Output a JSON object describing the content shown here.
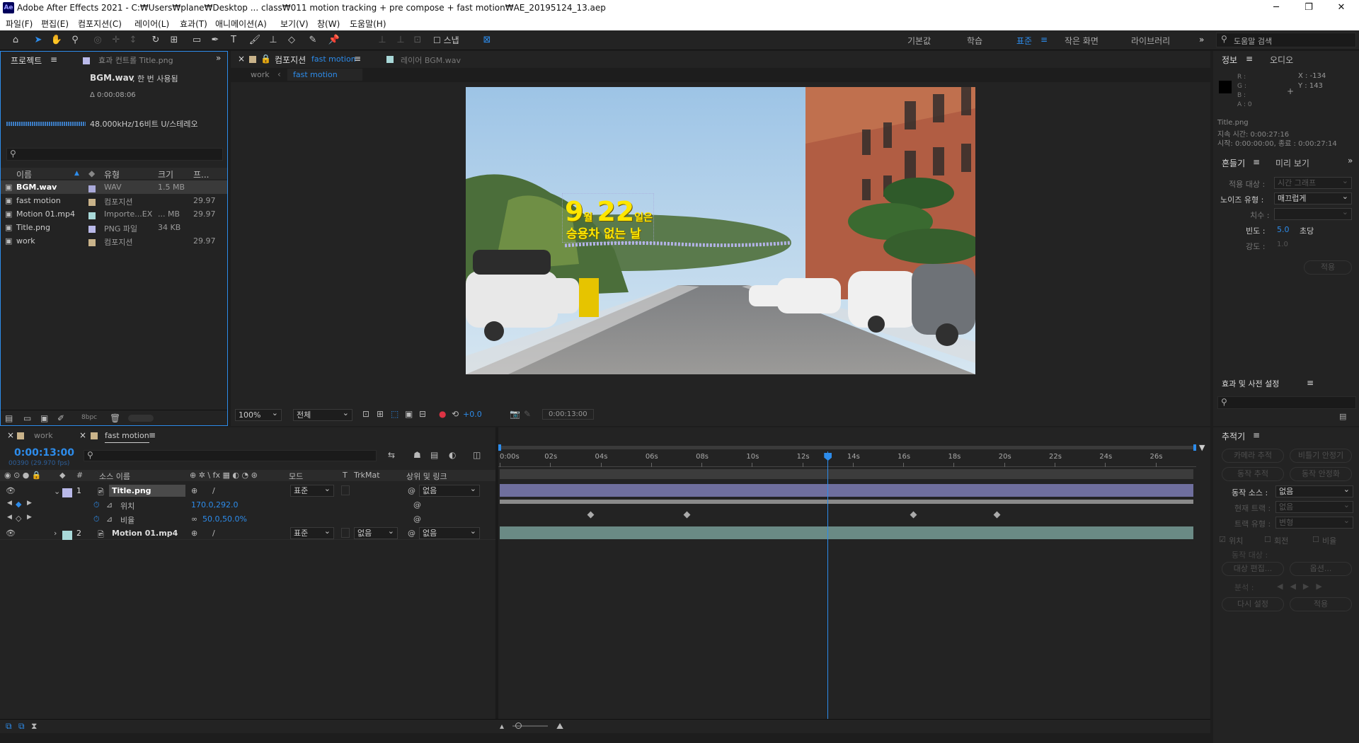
{
  "window": {
    "app_icon": "Ae",
    "title": "Adobe After Effects 2021 - C:₩Users₩plane₩Desktop ... class₩011 motion tracking + pre compose + fast motion₩AE_20195124_13.aep",
    "minimize": "─",
    "maximize": "❐",
    "close": "✕"
  },
  "menu": [
    "파일(F)",
    "편집(E)",
    "컴포지션(C)",
    "레이어(L)",
    "효과(T)",
    "애니메이션(A)",
    "보기(V)",
    "창(W)",
    "도움말(H)"
  ],
  "workspaces": {
    "items": [
      "기본값",
      "학습",
      "표준",
      "작은 화면",
      "라이브러리"
    ],
    "active": "표준",
    "search_placeholder": "도움말 검색",
    "expand": "»"
  },
  "project": {
    "tab": "프로젝트",
    "tab2": "효과 컨트롤 Title.png",
    "selected_name": "BGM.wav",
    "usage": ", 한 번 사용됨",
    "duration": "Δ 0:00:08:06",
    "audio_info": "48.000kHz/16비트 U/스테레오",
    "search_placeholder": "",
    "cols": [
      "이름",
      "유형",
      "크기",
      "프..."
    ],
    "items": [
      {
        "name": "BGM.wav",
        "type": "WAV",
        "size": "1.5 MB",
        "fps": "",
        "color": "#a9a9d9",
        "icon": "audio-icon"
      },
      {
        "name": "fast motion",
        "type": "컴포지션",
        "size": "",
        "fps": "29.97",
        "color": "#c9b38a",
        "icon": "composition-icon"
      },
      {
        "name": "Motion 01.mp4",
        "type": "Importe...EX",
        "size": "... MB",
        "fps": "29.97",
        "color": "#a9d9d9",
        "icon": "footage-icon"
      },
      {
        "name": "Title.png",
        "type": "PNG 파일",
        "size": "34 KB",
        "fps": "",
        "color": "#b9b9e9",
        "icon": "image-icon"
      },
      {
        "name": "work",
        "type": "컴포지션",
        "size": "",
        "fps": "29.97",
        "color": "#c9b38a",
        "icon": "composition-icon"
      }
    ],
    "bpc": "8bpc"
  },
  "comp": {
    "tab": "컴포지션",
    "tab_comp": "fast motion",
    "layer_tab": "레이어 BGM.wav",
    "crumbs": [
      "work",
      "fast motion"
    ],
    "zoom": "100%",
    "resolution": "전체",
    "exposure": "+0.0",
    "timecode": "0:00:13:00",
    "overlay": {
      "num1": "9",
      "unit1": "월",
      "num2": "22",
      "unit2": "일은",
      "line2": "승용차 없는 날"
    }
  },
  "info": {
    "tab": "정보",
    "tab2": "오디오",
    "r": "R :",
    "g": "G :",
    "b": "B :",
    "a": "A :  0",
    "x": "X : -134",
    "y": "Y : 143",
    "layer": "Title.png",
    "duration": "지속 시간: 0:00:27:16",
    "start": "시작: 0:00:00:00, 종료 : 0:00:27:14"
  },
  "wiggler": {
    "tab": "흔들기",
    "tab2": "미리 보기",
    "apply_to_label": "적용 대상 :",
    "apply_to": "시간 그래프",
    "noise_label": "노이즈 유형 :",
    "noise": "매끄럽게",
    "dim_label": "치수 :",
    "freq_label": "빈도 :",
    "freq": "5.0",
    "freq_unit": "초당",
    "mag_label": "강도 :",
    "mag": "1.0",
    "apply": "적용"
  },
  "effects": {
    "tab": "효과 및 사전 설정",
    "search_placeholder": ""
  },
  "tracker": {
    "tab": "추적기",
    "cam": "카메라 추적",
    "stab": "비틀기 안정기",
    "track_motion": "동작 추적",
    "stabilize": "동작 안정화",
    "source_label": "동작 소스 :",
    "source": "없음",
    "current_label": "현재 트랙 :",
    "current": "없음",
    "type_label": "트랙 유형 :",
    "type": "변형",
    "pos": "위치",
    "rot": "회전",
    "scale": "비율",
    "target": "동작 대상 :",
    "edit_target": "대상 편집...",
    "options": "옵션...",
    "analyze": "분석 :",
    "reset": "다시 설정",
    "apply": "적용"
  },
  "timeline": {
    "tab1": "work",
    "tab2": "fast motion",
    "timecode": "0:00:13:00",
    "frames": "00390 (29.970 fps)",
    "search_placeholder": "",
    "cols": {
      "num": "#",
      "src": "소스 이름",
      "mode": "모드",
      "t": "T",
      "trk": "TrkMat",
      "parent": "상위 및 링크"
    },
    "layers": [
      {
        "num": "1",
        "name": "Title.png",
        "mode": "표준",
        "trk": "",
        "parent": "없음",
        "color": "#b9b9e9"
      },
      {
        "num": "2",
        "name": "Motion 01.mp4",
        "mode": "표준",
        "trk": "없음",
        "parent": "없음",
        "color": "#a9d9d9"
      }
    ],
    "props": [
      {
        "name": "위치",
        "value": "170.0,292.0"
      },
      {
        "name": "비율",
        "value": "50.0,50.0%"
      }
    ],
    "ticks": [
      "0:00s",
      "02s",
      "04s",
      "06s",
      "08s",
      "10s",
      "12s",
      "14s",
      "16s",
      "18s",
      "20s",
      "22s",
      "24s",
      "26s"
    ],
    "playhead_sec": 13,
    "duration_sec": 27.5,
    "keyframes_sec": [
      3.6,
      7.4,
      16.4,
      19.7
    ]
  }
}
